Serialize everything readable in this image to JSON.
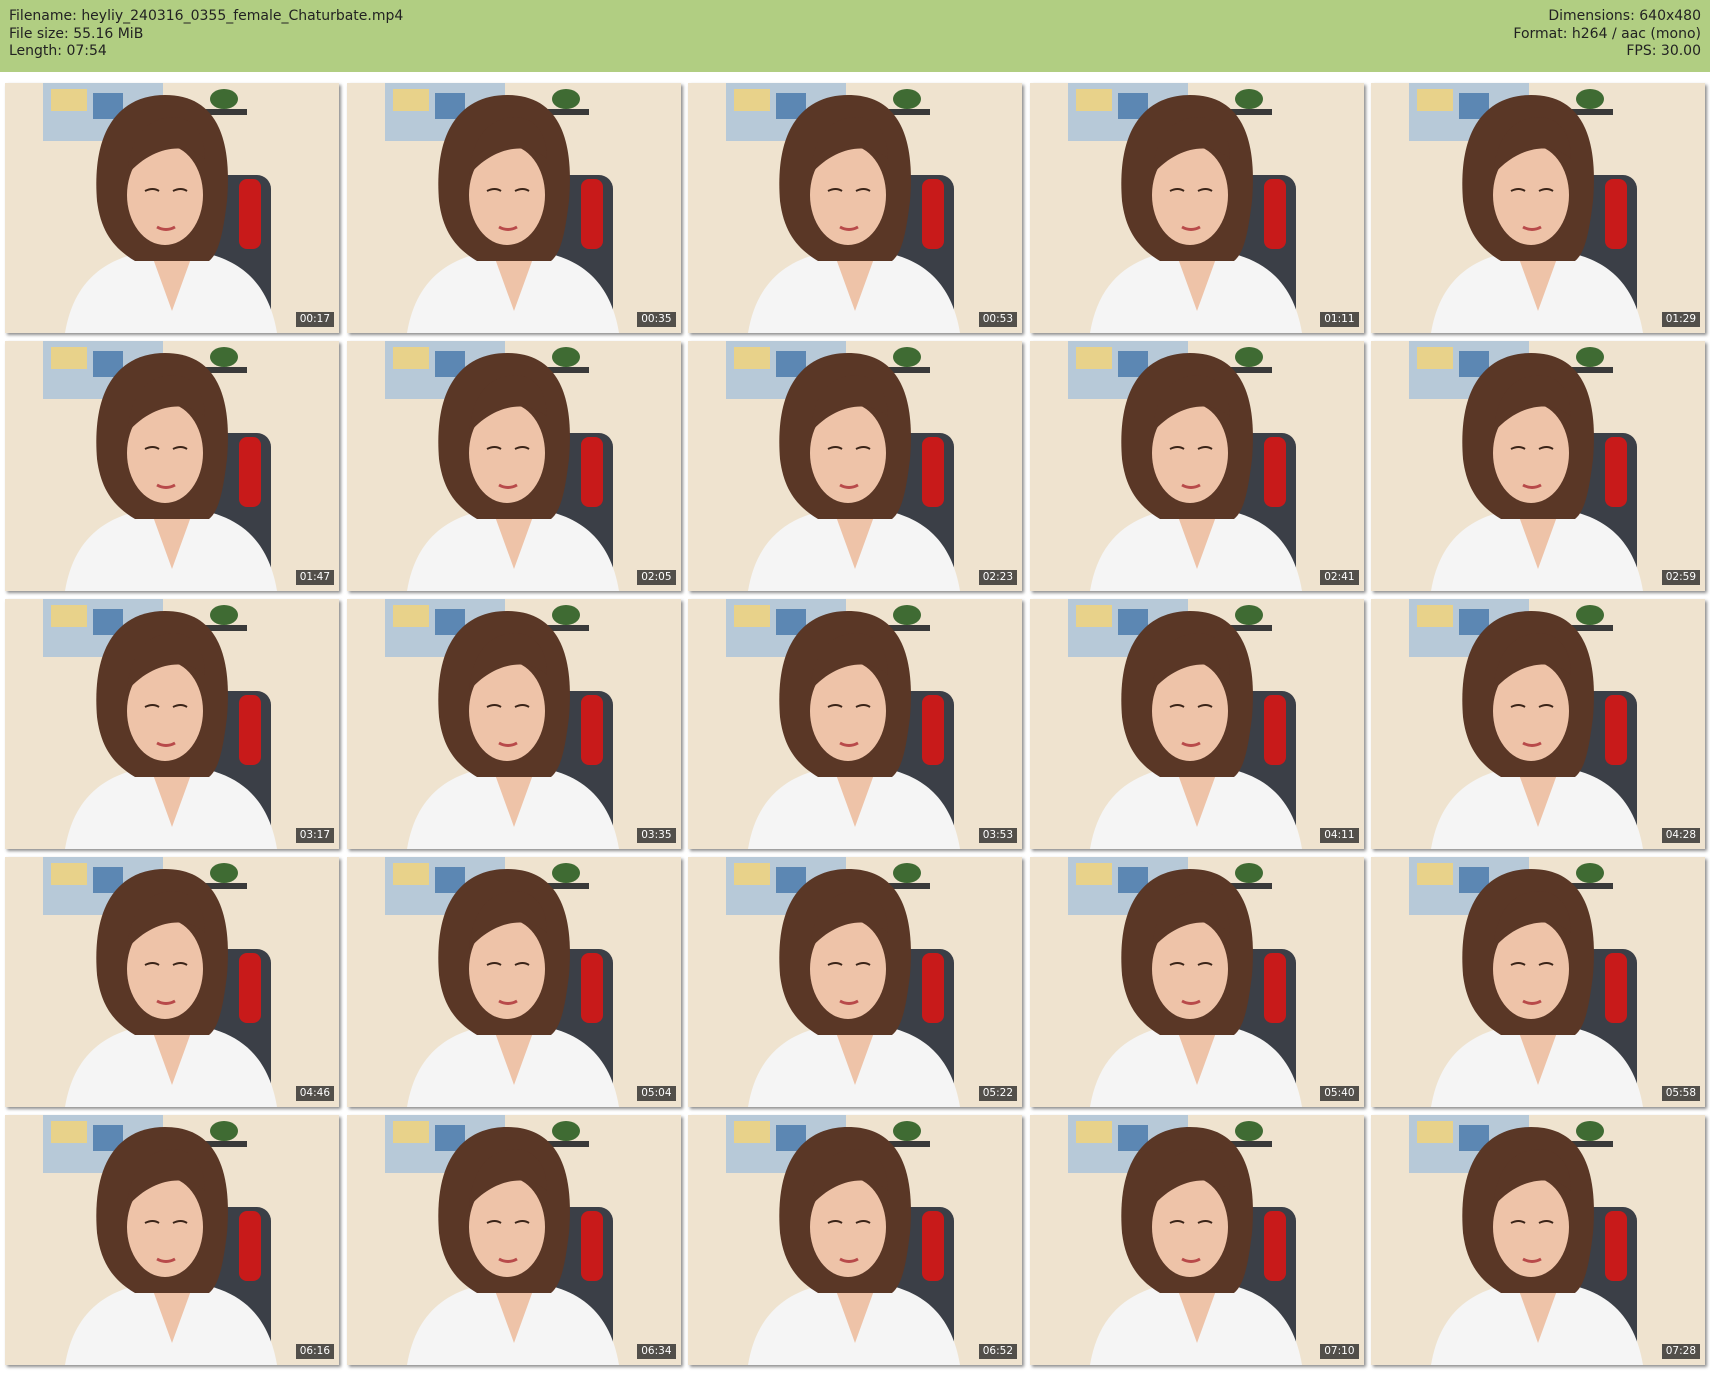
{
  "header": {
    "filename_label": "Filename:",
    "filename": "heyliy_240316_0355_female_Chaturbate.mp4",
    "filesize_label": "File size:",
    "filesize": "55.16 MiB",
    "length_label": "Length:",
    "length": "07:54",
    "dimensions_label": "Dimensions:",
    "dimensions": "640x480",
    "format_label": "Format:",
    "format": "h264 / aac (mono)",
    "fps_label": "FPS:",
    "fps": "30.00"
  },
  "thumbnails": [
    {
      "timestamp": "00:17"
    },
    {
      "timestamp": "00:35"
    },
    {
      "timestamp": "00:53"
    },
    {
      "timestamp": "01:11"
    },
    {
      "timestamp": "01:29"
    },
    {
      "timestamp": "01:47"
    },
    {
      "timestamp": "02:05"
    },
    {
      "timestamp": "02:23"
    },
    {
      "timestamp": "02:41"
    },
    {
      "timestamp": "02:59"
    },
    {
      "timestamp": "03:17"
    },
    {
      "timestamp": "03:35"
    },
    {
      "timestamp": "03:53"
    },
    {
      "timestamp": "04:11"
    },
    {
      "timestamp": "04:28"
    },
    {
      "timestamp": "04:46"
    },
    {
      "timestamp": "05:04"
    },
    {
      "timestamp": "05:22"
    },
    {
      "timestamp": "05:40"
    },
    {
      "timestamp": "05:58"
    },
    {
      "timestamp": "06:16"
    },
    {
      "timestamp": "06:34"
    },
    {
      "timestamp": "06:52"
    },
    {
      "timestamp": "07:10"
    },
    {
      "timestamp": "07:28"
    }
  ],
  "colors": {
    "header_bg": "#b1ce82",
    "wall": "#efe3cf",
    "hair": "#5a3726",
    "skin": "#eec3a8",
    "top": "#f5f5f5",
    "chair": "#3b3f47",
    "chair_accent": "#c81a1a"
  }
}
